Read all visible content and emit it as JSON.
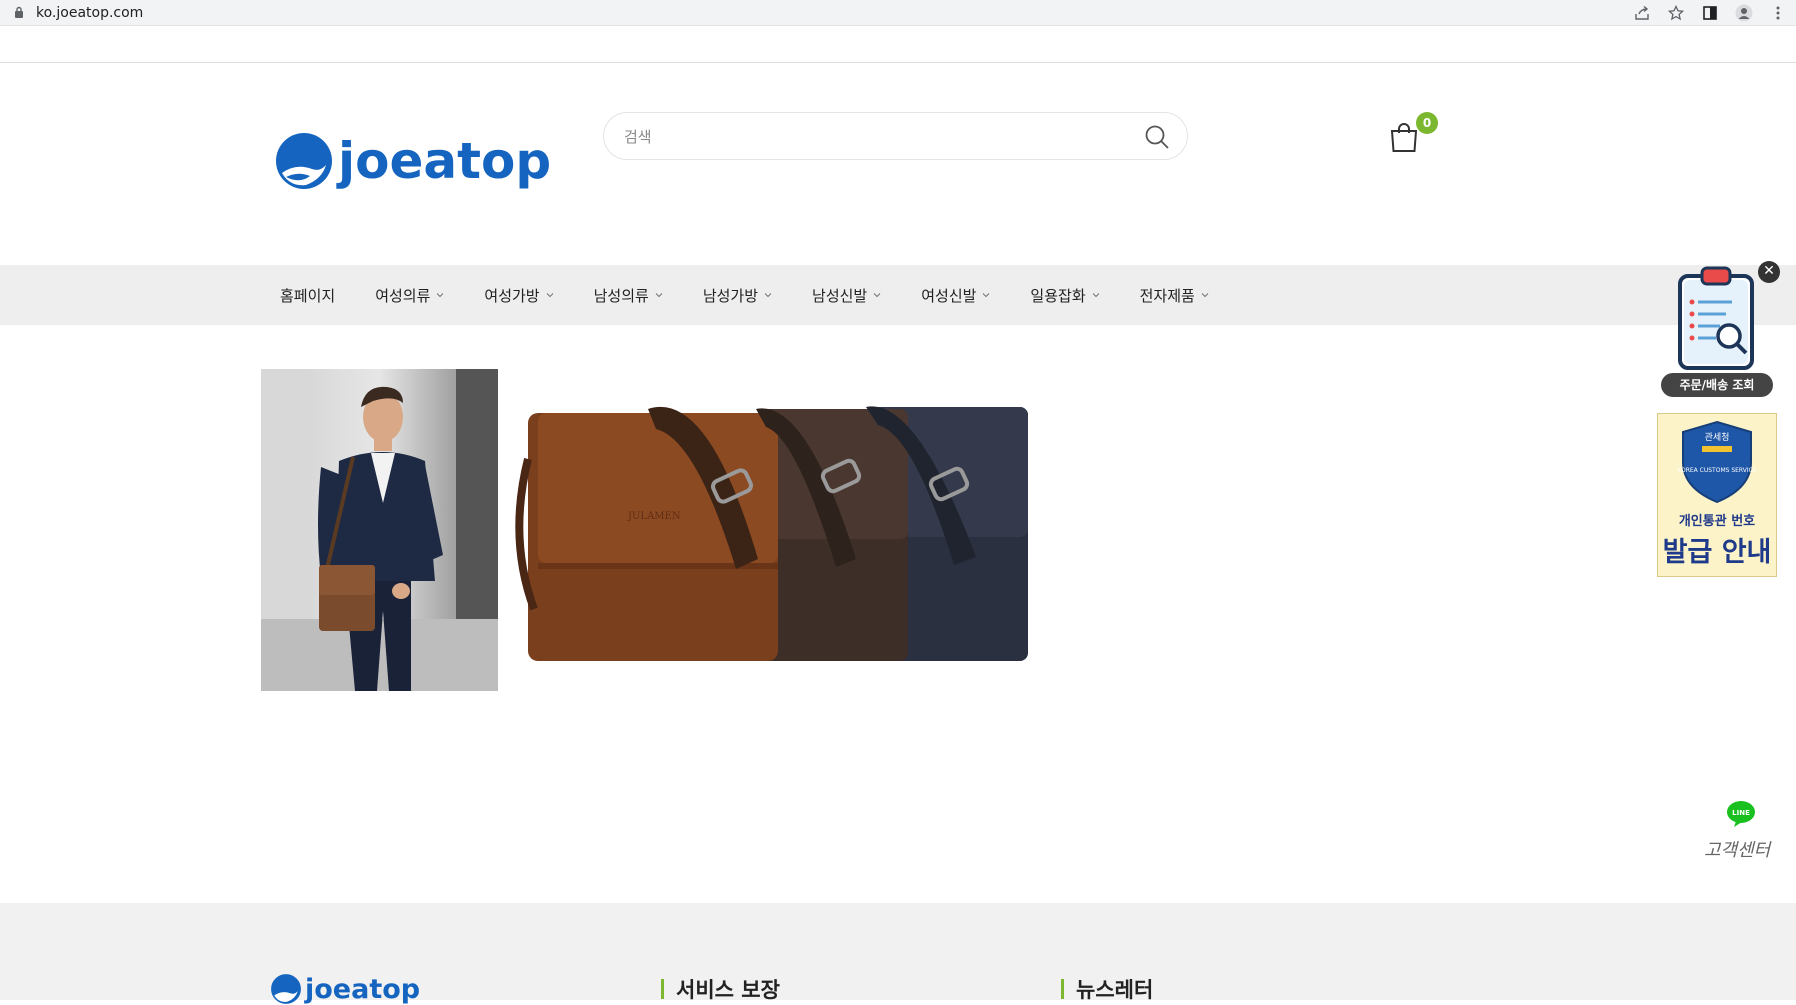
{
  "browser": {
    "url": "ko.joeatop.com"
  },
  "header": {
    "logo_text": "joeatop",
    "search_placeholder": "검색",
    "cart_count": "0"
  },
  "nav": {
    "items": [
      {
        "label": "홈페이지",
        "has_dropdown": false
      },
      {
        "label": "여성의류",
        "has_dropdown": true
      },
      {
        "label": "여성가방",
        "has_dropdown": true
      },
      {
        "label": "남성의류",
        "has_dropdown": true
      },
      {
        "label": "남성가방",
        "has_dropdown": true
      },
      {
        "label": "남성신발",
        "has_dropdown": true
      },
      {
        "label": "여성신발",
        "has_dropdown": true
      },
      {
        "label": "일용잡화",
        "has_dropdown": true
      },
      {
        "label": "전자제품",
        "has_dropdown": true
      }
    ]
  },
  "product": {
    "bag_brand_text": "JULAMEN"
  },
  "floating": {
    "order_label": "주문/배송 조회",
    "customs_badge_top": "관세청",
    "customs_badge_mid": "KOREA CUSTOMS SERVICE",
    "customs_sub": "개인통관 번호",
    "customs_main": "발급 안내",
    "line_label": "LINE",
    "cs_text": "고객센터"
  },
  "footer": {
    "logo_text": "joeatop",
    "col1_title": "서비스 보장",
    "col2_title": "뉴스레터"
  },
  "colors": {
    "brand_blue": "#1565c0",
    "accent_green": "#7cb82f",
    "nav_bg": "#eeeeee",
    "footer_bg": "#f1f1f1"
  }
}
